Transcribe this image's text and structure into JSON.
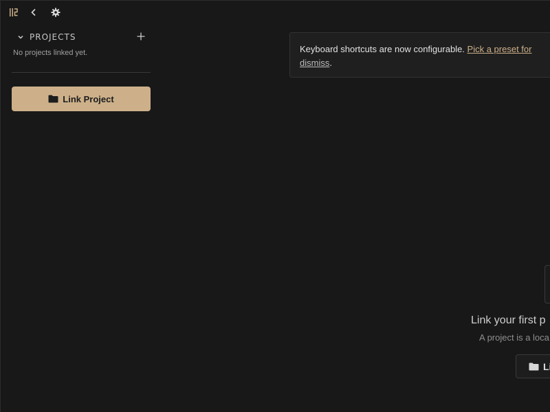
{
  "toolbar": {
    "icons": [
      "sidebar-toggle-icon",
      "back-icon",
      "gear-icon"
    ]
  },
  "sidebar": {
    "projects_title": "PROJECTS",
    "empty_text": "No projects linked yet.",
    "link_button_label": "Link Project"
  },
  "toast": {
    "message": "Keyboard shortcuts are now configurable.",
    "link_text": "Pick a preset for",
    "dismiss_text": "dismiss",
    "dismiss_suffix": "."
  },
  "empty_state": {
    "title": "Link your first p",
    "subtitle": "A project is a loca",
    "button_label": "Li"
  },
  "colors": {
    "background": "#181818",
    "accent": "#cdb08a",
    "text": "#e6e6e6",
    "muted": "#a0a0a0"
  }
}
